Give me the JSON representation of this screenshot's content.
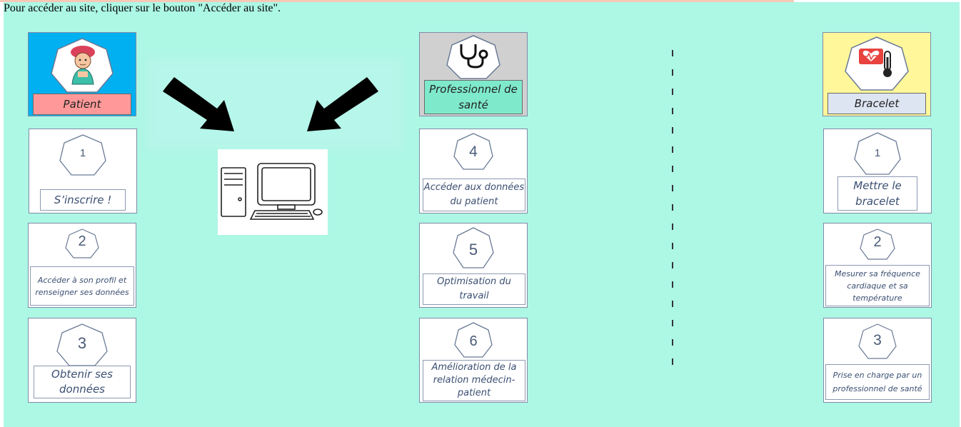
{
  "instruction": "Pour accéder au site, cliquer sur le bouton \"Accéder au site\".",
  "colors": {
    "background": "#adf7e5",
    "patient_header": "#00b0f0",
    "patient_label": "#ff9999",
    "pro_header": "#d0d0d0",
    "pro_label": "#7eeacb",
    "bracelet_header": "#fff799",
    "bracelet_label": "#dde4f2"
  },
  "columns": {
    "patient": {
      "label": "Patient",
      "icon": "patient-avatar-icon",
      "steps": [
        {
          "number": "1",
          "text": "S’inscrire !"
        },
        {
          "number": "2",
          "text": "Accéder à son profil et renseigner ses données"
        },
        {
          "number": "3",
          "text": "Obtenir ses données"
        }
      ]
    },
    "professional": {
      "label": "Professionnel de santé",
      "icon": "stethoscope-icon",
      "steps": [
        {
          "number": "4",
          "text": "Accéder aux données du patient"
        },
        {
          "number": "5",
          "text": "Optimisation du travail"
        },
        {
          "number": "6",
          "text": "Amélioration de la relation médecin-patient"
        }
      ]
    },
    "bracelet": {
      "label": "Bracelet",
      "icon": "heart-thermometer-icon",
      "steps": [
        {
          "number": "1",
          "text": "Mettre le bracelet"
        },
        {
          "number": "2",
          "text": "Mesurer sa fréquence cardiaque et sa température"
        },
        {
          "number": "3",
          "text": "Prise en charge par un professionnel de santé"
        }
      ]
    }
  },
  "center": {
    "icon": "desktop-computer-icon",
    "arrows": [
      "arrow-down-right-icon",
      "arrow-down-left-icon"
    ]
  }
}
